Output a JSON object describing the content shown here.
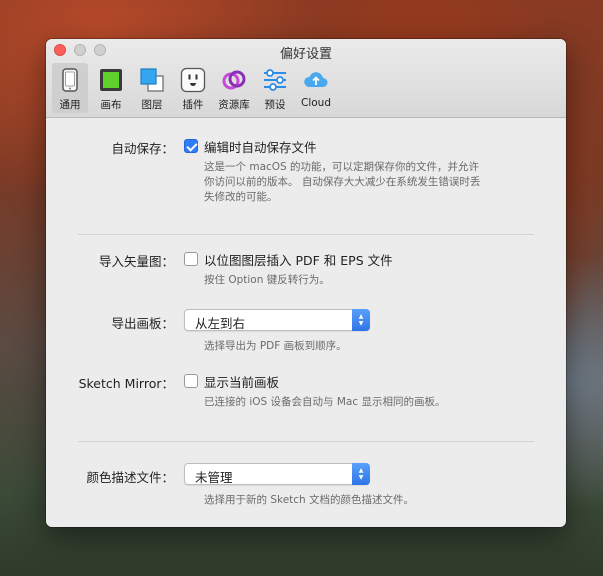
{
  "window": {
    "title": "偏好设置"
  },
  "toolbar": {
    "items": [
      {
        "label": "通用",
        "icon": "phone-icon",
        "active": true
      },
      {
        "label": "画布",
        "icon": "canvas-icon"
      },
      {
        "label": "图层",
        "icon": "layers-icon"
      },
      {
        "label": "插件",
        "icon": "plugin-icon"
      },
      {
        "label": "资源库",
        "icon": "library-icon"
      },
      {
        "label": "预设",
        "icon": "presets-icon"
      },
      {
        "label": "Cloud",
        "icon": "cloud-icon"
      }
    ]
  },
  "autosave": {
    "label": "自动保存：",
    "checkbox_label": "编辑时自动保存文件",
    "checked": true,
    "desc": [
      "这是一个 macOS 的功能，可以定期保存你的文件，并允许",
      "你访问以前的版本。 自动保存大大减少在系统发生错误时丢",
      "失修改的可能。"
    ]
  },
  "import_vector": {
    "label": "导入矢量图：",
    "checkbox_label": "以位图图层插入 PDF 和 EPS 文件",
    "checked": false,
    "desc": "按住 Option 键反转行为。"
  },
  "export_artboards": {
    "label": "导出画板：",
    "value": "从左到右",
    "desc": "选择导出为 PDF 画板到顺序。"
  },
  "sketch_mirror": {
    "label": "Sketch Mirror：",
    "checkbox_label": "显示当前画板",
    "checked": false,
    "desc": "已连接的 iOS 设备会自动与 Mac 显示相同的画板。"
  },
  "color_profile": {
    "label": "颜色描述文件：",
    "value": "未管理",
    "desc": "选择用于新的 Sketch 文档的颜色描述文件。"
  },
  "colors": {
    "accent": "#2f7ef6",
    "close": "#fc605c"
  }
}
